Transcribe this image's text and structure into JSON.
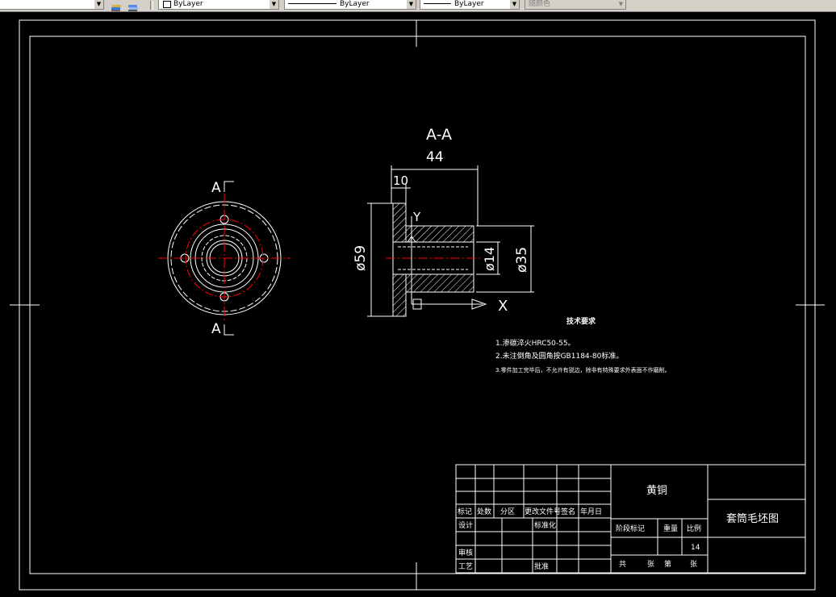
{
  "toolbar": {
    "layer_color": "ByLayer",
    "linetype": "ByLayer",
    "lineweight": "ByLayer",
    "plot_style": "随颜色"
  },
  "drawing": {
    "section_label": "A-A",
    "dim_44": "44",
    "dim_10": "10",
    "dim_59": "ø59",
    "dim_14": "ø14",
    "dim_35": "ø35",
    "axis_x": "X",
    "axis_y": "Y",
    "cut_top": "A",
    "cut_bottom": "A",
    "notes_title": "技术要求",
    "notes": [
      "1.渗碳淬火HRC50-55。",
      "2.未注倒角及圆角按GB1184-80标准。",
      "3.零件加工完毕后，不允许有锐边，除非有特殊要求外表面不作磨削。"
    ]
  },
  "title_block": {
    "material": "黄铜",
    "part_name": "套筒毛坯图",
    "sheet": "14",
    "row_labels": [
      "标记",
      "处数",
      "分区",
      "更改文件号",
      "签名",
      "年月日"
    ],
    "design_label": "设计",
    "standardize_label": "标准化",
    "review_label": "审核",
    "process_label": "工艺",
    "approve_label": "批准",
    "stage_labels": [
      "阶段标记",
      "重量",
      "比例"
    ],
    "sheet_labels": [
      "共",
      "张",
      "第",
      "张"
    ]
  },
  "colors": {
    "background": "#000000",
    "lines": "#ffffff",
    "centerline": "#ff0000",
    "toolbar": "#d4d0c8"
  }
}
